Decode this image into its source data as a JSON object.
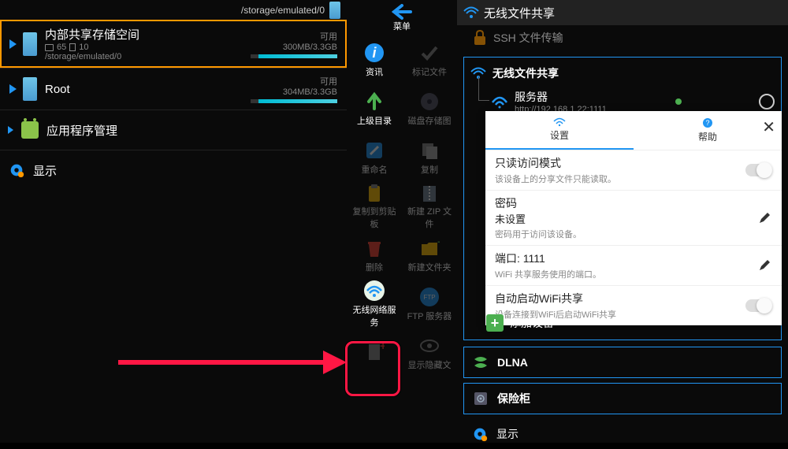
{
  "panel1": {
    "path": "/storage/emulated/0",
    "storages": [
      {
        "title": "内部共享存储空间",
        "folders": "65",
        "files": "10",
        "sub_path": "/storage/emulated/0",
        "status": "可用",
        "size": "300MB/3.3GB",
        "fill_pct": 91
      },
      {
        "title": "Root",
        "folders": "",
        "files": "",
        "sub_path": "",
        "status": "可用",
        "size": "304MB/3.3GB",
        "fill_pct": 91
      }
    ],
    "app_mgr": "应用程序管理",
    "display": "显示"
  },
  "panel2": {
    "back": "菜单",
    "cells": [
      {
        "label": "资讯",
        "dim": false
      },
      {
        "label": "标记文件",
        "dim": true
      },
      {
        "label": "上级目录",
        "dim": false
      },
      {
        "label": "磁盘存储图",
        "dim": true
      },
      {
        "label": "重命名",
        "dim": true
      },
      {
        "label": "复制",
        "dim": true
      },
      {
        "label": "复制到剪贴板",
        "dim": true
      },
      {
        "label": "新建 ZIP 文件",
        "dim": true
      },
      {
        "label": "删除",
        "dim": true
      },
      {
        "label": "新建文件夹",
        "dim": true
      },
      {
        "label": "无线网络服务",
        "dim": false
      },
      {
        "label": "FTP 服务器",
        "dim": true
      },
      {
        "label": "",
        "dim": true
      },
      {
        "label": "显示隐藏文",
        "dim": true
      }
    ]
  },
  "panel3": {
    "header": "无线文件共享",
    "ssh": "SSH 文件传输",
    "wifi_title": "无线文件共享",
    "server": {
      "label": "服务器",
      "url": "http://192.168.1.22:1111"
    },
    "tabs": {
      "settings": "设置",
      "help": "帮助"
    },
    "settings_items": [
      {
        "title": "只读访问模式",
        "sub": "该设备上的分享文件只能读取。",
        "type": "toggle"
      },
      {
        "title": "密码",
        "value": "未设置",
        "sub": "密码用于访问该设备。",
        "type": "edit"
      },
      {
        "title": "端口: 1111",
        "sub": "WiFi 共享服务使用的端口。",
        "type": "edit"
      },
      {
        "title": "自动启动WiFi共享",
        "sub": "设备连接到WiFi后启动WiFi共享",
        "type": "toggle"
      }
    ],
    "add_device": "添加设备",
    "dlna": "DLNA",
    "vault": "保险柜",
    "display": "显示"
  }
}
